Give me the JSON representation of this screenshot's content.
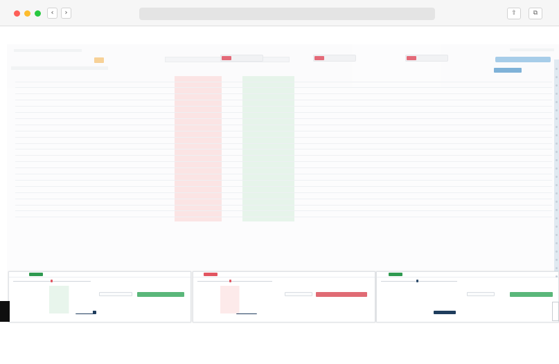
{
  "browser": {
    "traffic_lights": [
      "#fe5f58",
      "#fdbc2e",
      "#28c840"
    ],
    "back": "‹",
    "forward": "›",
    "share": "⇧",
    "tabs": "⧉"
  },
  "app": {
    "orange_buttons_count": 3,
    "top_tags": [
      "",
      "",
      ""
    ],
    "panel_left_name": "خودرو",
    "panel_mid_name": "فولاد",
    "panel_right_name": "خودرو"
  },
  "table": {
    "rows": [
      [
        "",
        "",
        "",
        "",
        "",
        "",
        "",
        "",
        "",
        "",
        "",
        ""
      ],
      [
        "",
        "",
        "",
        "",
        "",
        "",
        "",
        "",
        "",
        "",
        "",
        ""
      ],
      [
        "",
        "",
        "",
        "",
        "",
        "",
        "",
        "",
        "",
        "",
        "",
        ""
      ],
      [
        "",
        "",
        "",
        "",
        "",
        "",
        "",
        "",
        "",
        "",
        "",
        ""
      ],
      [
        "",
        "",
        "",
        "",
        "",
        "",
        "",
        "",
        "",
        "",
        "",
        ""
      ],
      [
        "",
        "",
        "",
        "",
        "",
        "",
        "",
        "",
        "",
        "",
        "",
        ""
      ],
      [
        "",
        "",
        "",
        "",
        "",
        "",
        "",
        "",
        "",
        "",
        "",
        ""
      ],
      [
        "",
        "",
        "",
        "",
        "",
        "",
        "",
        "",
        "",
        "",
        "",
        ""
      ],
      [
        "",
        "",
        "",
        "",
        "",
        "",
        "",
        "",
        "",
        "",
        "",
        ""
      ],
      [
        "",
        "",
        "",
        "",
        "",
        "",
        "",
        "",
        "",
        "",
        "",
        ""
      ],
      [
        "",
        "",
        "",
        "",
        "",
        "",
        "",
        "",
        "",
        "",
        "",
        ""
      ],
      [
        "",
        "",
        "",
        "",
        "",
        "",
        "",
        "",
        "",
        "",
        "",
        ""
      ],
      [
        "",
        "",
        "",
        "",
        "",
        "",
        "",
        "",
        "",
        "",
        "",
        ""
      ],
      [
        "",
        "",
        "",
        "",
        "",
        "",
        "",
        "",
        "",
        "",
        "",
        ""
      ],
      [
        "",
        "",
        "",
        "",
        "",
        "",
        "",
        "",
        "",
        "",
        "",
        ""
      ],
      [
        "",
        "",
        "",
        "",
        "",
        "",
        "",
        "",
        "",
        "",
        "",
        ""
      ],
      [
        "",
        "",
        "",
        "",
        "",
        "",
        "",
        "",
        "",
        "",
        "",
        ""
      ],
      [
        "",
        "",
        "",
        "",
        "",
        "",
        "",
        "",
        "",
        "",
        "",
        ""
      ],
      [
        "",
        "",
        "",
        "",
        "",
        "",
        "",
        "",
        "",
        "",
        "",
        ""
      ],
      [
        "",
        "",
        "",
        "",
        "",
        "",
        "",
        "",
        "",
        "",
        "",
        ""
      ],
      [
        "",
        "",
        "",
        "",
        "",
        "",
        "",
        "",
        "",
        "",
        "",
        ""
      ],
      [
        "",
        "",
        "",
        "",
        "",
        "",
        "",
        "",
        "",
        "",
        "",
        ""
      ],
      [
        "",
        "",
        "",
        "",
        "",
        "",
        "",
        "",
        "",
        "",
        "",
        ""
      ]
    ]
  },
  "panels": [
    {
      "title": "",
      "tag": "",
      "type": "buy"
    },
    {
      "title": "",
      "tag": "",
      "type": "sell"
    },
    {
      "title": "",
      "tag": "",
      "type": "buy"
    }
  ]
}
